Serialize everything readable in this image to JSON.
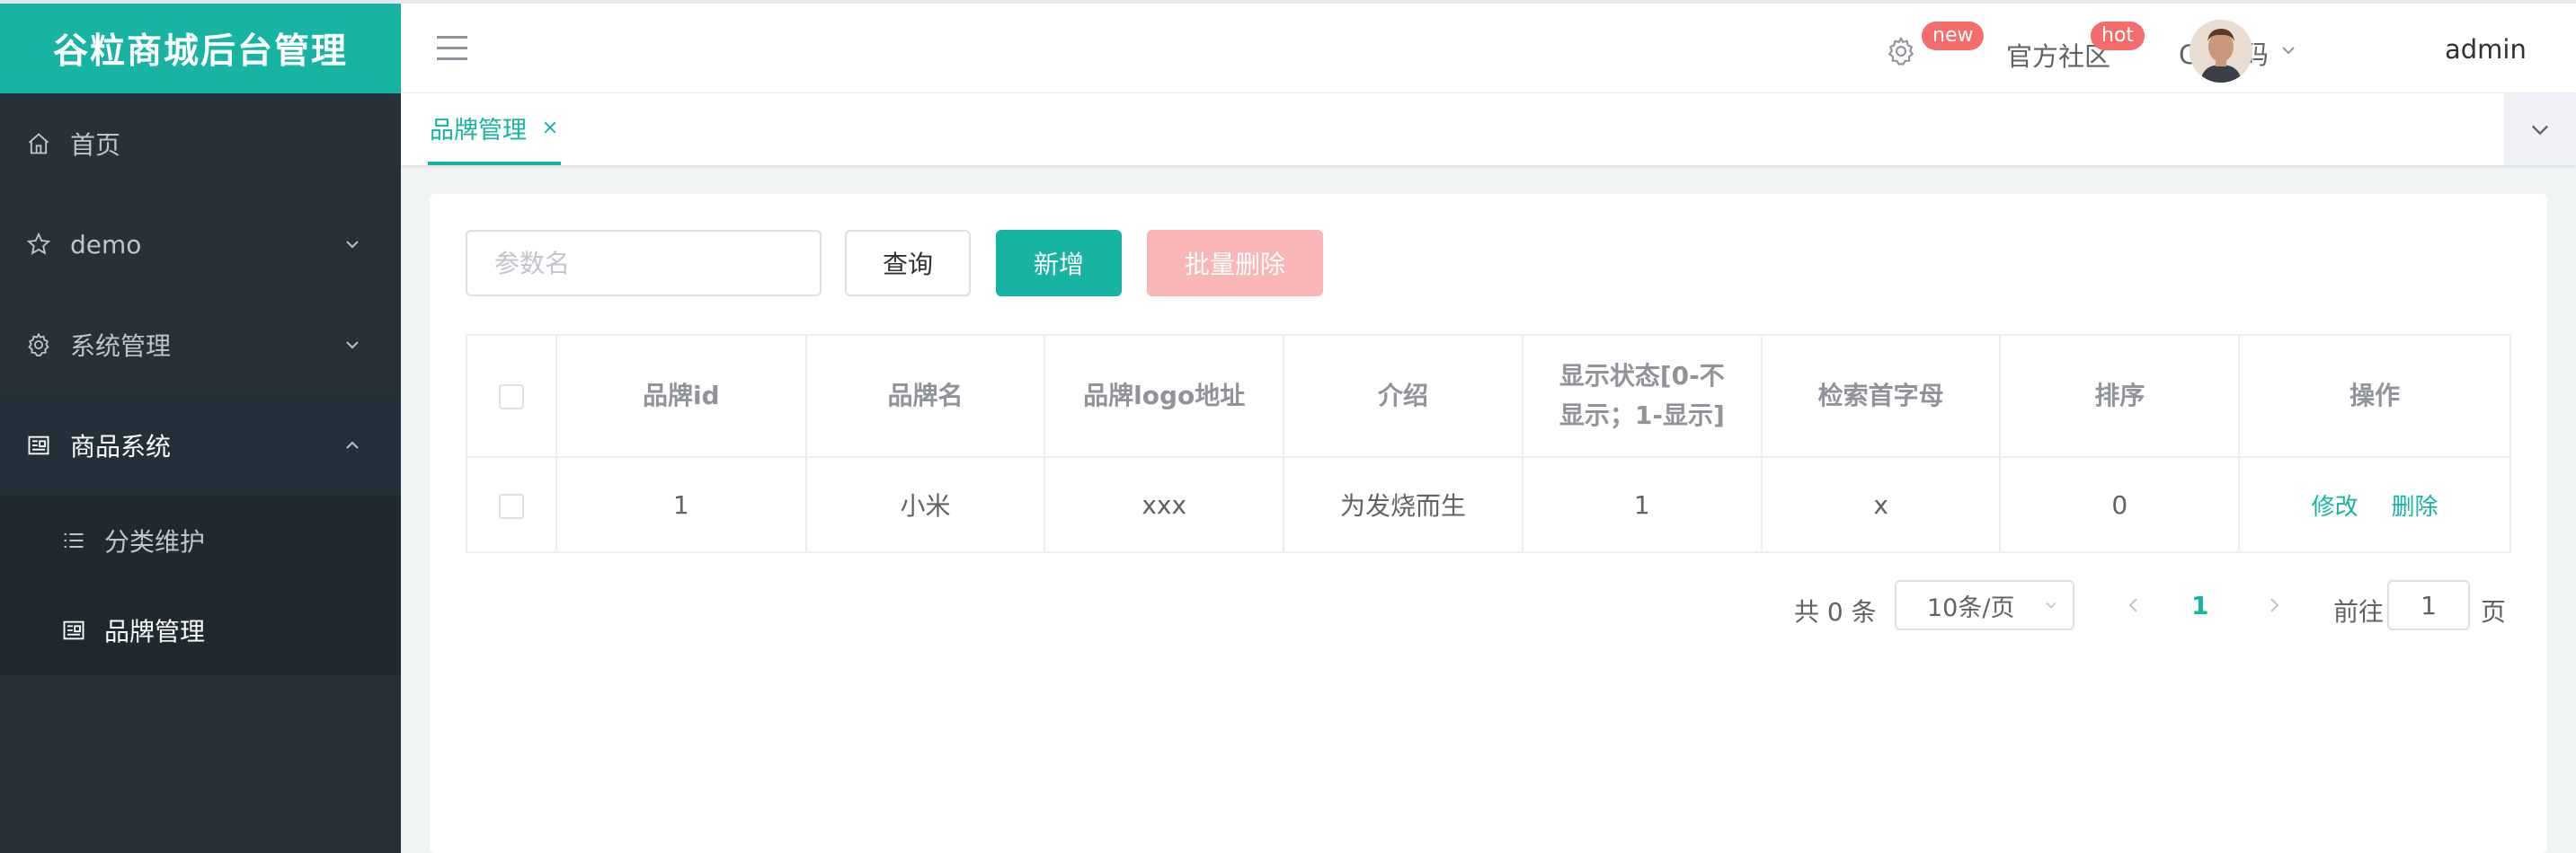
{
  "app": {
    "title": "谷粒商城后台管理"
  },
  "sidebar": {
    "items": [
      {
        "label": "首页",
        "icon": "home-icon"
      },
      {
        "label": "demo",
        "icon": "star-icon"
      },
      {
        "label": "系统管理",
        "icon": "gear-icon"
      },
      {
        "label": "商品系统",
        "icon": "list-doc-icon"
      }
    ],
    "submenu": [
      {
        "label": "分类维护",
        "icon": "list-icon"
      },
      {
        "label": "品牌管理",
        "icon": "doc-icon",
        "active": true
      }
    ]
  },
  "header": {
    "badge_new": "new",
    "community": "官方社区",
    "badge_hot": "hot",
    "git": "Git源码",
    "user": "admin"
  },
  "tabs": [
    {
      "label": "品牌管理",
      "active": true
    }
  ],
  "toolbar": {
    "search_placeholder": "参数名",
    "query_label": "查询",
    "add_label": "新增",
    "batch_delete_label": "批量删除"
  },
  "table": {
    "headers": [
      "品牌id",
      "品牌名",
      "品牌logo地址",
      "介绍",
      "显示状态[0-不显示；1-显示]",
      "检索首字母",
      "排序",
      "操作"
    ],
    "rows": [
      {
        "id": "1",
        "name": "小米",
        "logo": "xxx",
        "intro": "为发烧而生",
        "show_status": "1",
        "first_letter": "x",
        "sort": "0",
        "edit": "修改",
        "delete": "删除"
      }
    ]
  },
  "pagination": {
    "total": "共 0 条",
    "page_size": "10条/页",
    "current": "1",
    "goto_prefix": "前往",
    "goto_value": "1",
    "goto_suffix": "页"
  },
  "colors": {
    "accent": "#17b3a3",
    "sidebar_bg": "#263238",
    "danger_light": "#fab6b6",
    "badge": "#f56c6c"
  }
}
